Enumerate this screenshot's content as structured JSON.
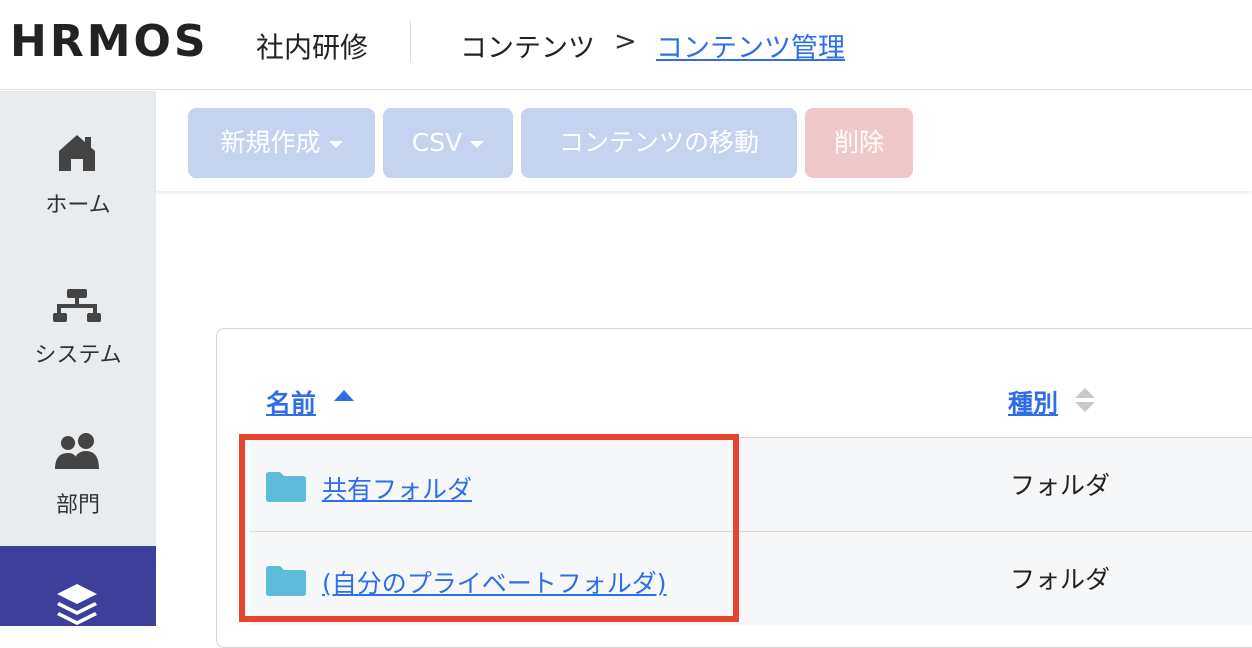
{
  "header": {
    "logo": "HRMOS",
    "product": "社内研修",
    "breadcrumb": {
      "parent": "コンテンツ",
      "separator": ">",
      "current": "コンテンツ管理"
    }
  },
  "sidebar": {
    "items": [
      {
        "label": "ホーム",
        "icon": "home-icon"
      },
      {
        "label": "システム",
        "icon": "system-icon"
      },
      {
        "label": "部門",
        "icon": "department-icon"
      },
      {
        "label": "",
        "icon": "layers-icon",
        "active": true
      }
    ]
  },
  "toolbar": {
    "new_label": "新規作成",
    "csv_label": "CSV",
    "move_label": "コンテンツの移動",
    "delete_label": "削除"
  },
  "table": {
    "columns": [
      {
        "label": "名前",
        "sort": "ascending"
      },
      {
        "label": "種別",
        "sort": "none"
      }
    ],
    "rows": [
      {
        "name": "共有フォルダ",
        "type": "フォルダ",
        "icon": "folder-icon"
      },
      {
        "name": "(自分のプライベートフォルダ)",
        "type": "フォルダ",
        "icon": "folder-icon"
      }
    ]
  },
  "colors": {
    "accent": "#2f6ee6",
    "sidebar_active": "#3d3f9a",
    "highlight": "#e8432c",
    "button_disabled": "#c5d3f1",
    "delete_disabled": "#f1c8c9"
  }
}
